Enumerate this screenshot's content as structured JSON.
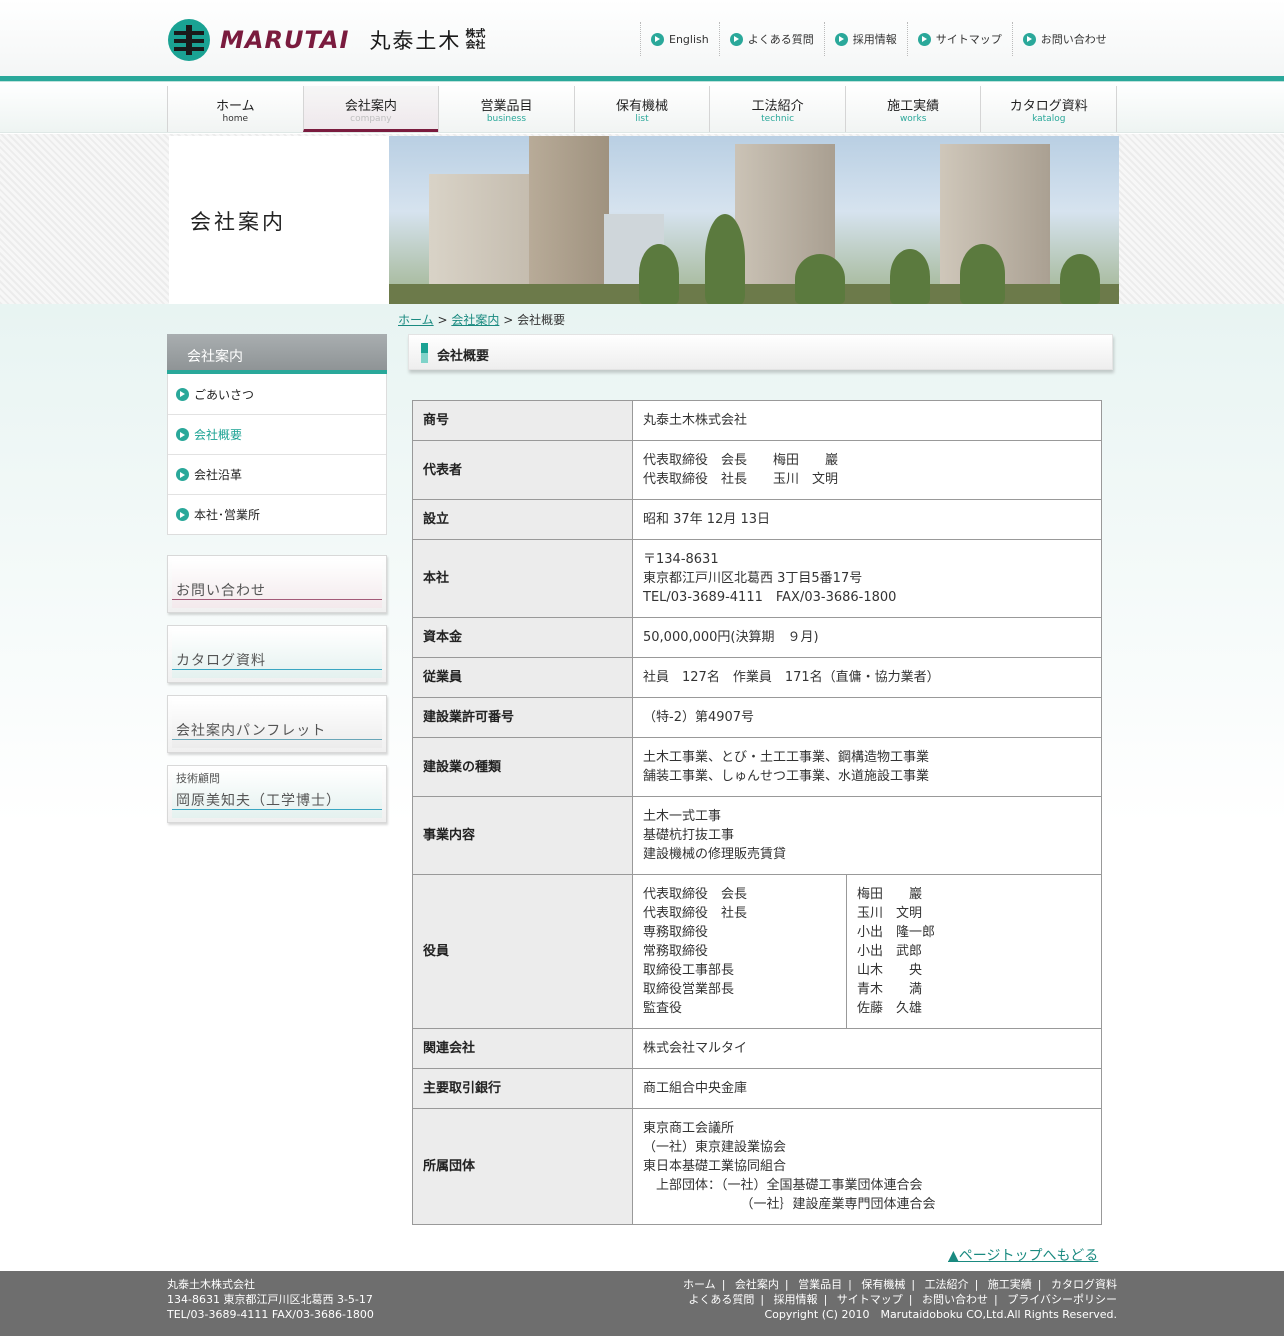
{
  "header": {
    "logo_word": "MARUTAI",
    "logo_name": "丸泰土木",
    "logo_suffix": "株式会社",
    "top_links": [
      "English",
      "よくある質問",
      "採用情報",
      "サイトマップ",
      "お問い合わせ"
    ]
  },
  "gnav": [
    {
      "jp": "ホーム",
      "en": "home"
    },
    {
      "jp": "会社案内",
      "en": "company"
    },
    {
      "jp": "営業品目",
      "en": "business"
    },
    {
      "jp": "保有機械",
      "en": "list"
    },
    {
      "jp": "工法紹介",
      "en": "technic"
    },
    {
      "jp": "施工実績",
      "en": "works"
    },
    {
      "jp": "カタログ資料",
      "en": "katalog"
    }
  ],
  "banner": {
    "title": "会社案内"
  },
  "breadcrumb": {
    "home": "ホーム",
    "sep": ">",
    "company": "会社案内",
    "current": "会社概要"
  },
  "sidebar": {
    "heading": "会社案内",
    "items": [
      "ごあいさつ",
      "会社概要",
      "会社沿革",
      "本社･営業所"
    ],
    "buttons": {
      "contact": "お問い合わせ",
      "catalog": "カタログ資料",
      "pamphlet": "会社案内パンフレット",
      "advisor_sub": "技術顧問",
      "advisor": "岡原美知夫（工学博士）"
    }
  },
  "content": {
    "title": "会社概要",
    "rows": {
      "trade_name": {
        "label": "商号",
        "value": "丸泰土木株式会社"
      },
      "representative": {
        "label": "代表者",
        "lines": [
          "代表取締役　会長　　梅田　　巖",
          "代表取締役　社長　　玉川　文明"
        ]
      },
      "established": {
        "label": "設立",
        "value": "昭和 37年 12月 13日"
      },
      "head_office": {
        "label": "本社",
        "lines": [
          "〒134-8631",
          "東京都江戸川区北葛西 3丁目5番17号",
          "TEL/03-3689-4111　FAX/03-3686-1800"
        ]
      },
      "capital": {
        "label": "資本金",
        "value": "50,000,000円(決算期　９月)"
      },
      "employees": {
        "label": "従業員",
        "value": "社員　127名　作業員　171名（直傭・協力業者）"
      },
      "license": {
        "label": "建設業許可番号",
        "value": "（特-2）第4907号"
      },
      "business_types": {
        "label": "建設業の種類",
        "lines": [
          "土木工事業、とび・土工工事業、鋼構造物工事業",
          "舗装工事業、しゅんせつ工事業、水道施設工事業"
        ]
      },
      "business": {
        "label": "事業内容",
        "lines": [
          "土木一式工事",
          "基礎杭打抜工事",
          "建設機械の修理販売賃貸"
        ]
      },
      "officers": {
        "label": "役員",
        "titles": [
          "代表取締役　会長",
          "代表取締役　社長",
          "専務取締役",
          "常務取締役",
          "取締役工事部長",
          "取締役営業部長",
          "監査役"
        ],
        "names": [
          "梅田　　巖",
          "玉川　文明",
          "小出　隆一郎",
          "小出　武郎",
          "山木　　央",
          "青木　　満",
          "佐藤　久雄"
        ]
      },
      "affiliate": {
        "label": "関連会社",
        "value": "株式会社マルタイ"
      },
      "bank": {
        "label": "主要取引銀行",
        "value": "商工組合中央金庫"
      },
      "associations": {
        "label": "所属団体",
        "lines": [
          "東京商工会議所",
          "（一社）東京建設業協会",
          "東日本基礎工業協同組合",
          "　上部団体：（一社）全国基礎工事業団体連合会",
          "　　　　　　　　（一社｝建設産業専門団体連合会"
        ]
      }
    }
  },
  "pagetop": "▲ページトップへもどる",
  "footer": {
    "company": "丸泰土木株式会社",
    "address": "134-8631 東京都江戸川区北葛西 3-5-17",
    "tel": "TEL/03-3689-4111 FAX/03-3686-1800",
    "links1": [
      "ホーム",
      "会社案内",
      "営業品目",
      "保有機械",
      "工法紹介",
      "施工実績",
      "カタログ資料"
    ],
    "links2": [
      "よくある質問",
      "採用情報",
      "サイトマップ",
      "お問い合わせ",
      "プライバシーポリシー"
    ],
    "separator": "|",
    "copyright": "Copyright (C) 2010　Marutaidoboku CO,Ltd.All Rights Reserved."
  },
  "colors": {
    "accent": "#2aa89a",
    "brand": "#7a1b3e",
    "footer": "#6e6e6e"
  }
}
